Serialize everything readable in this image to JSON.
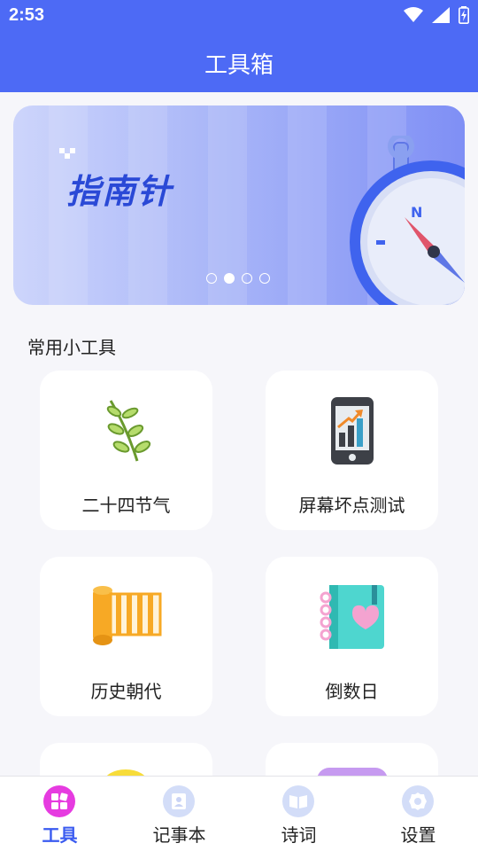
{
  "status_bar": {
    "time": "2:53"
  },
  "app_bar": {
    "title": "工具箱"
  },
  "banner": {
    "title": "指南针",
    "page_indicator": {
      "count": 4,
      "active_index": 1
    }
  },
  "section": {
    "title": "常用小工具"
  },
  "tools": [
    {
      "label": "二十四节气",
      "icon": "leaf-branch-icon"
    },
    {
      "label": "屏幕坏点测试",
      "icon": "phone-chart-icon"
    },
    {
      "label": "历史朝代",
      "icon": "scroll-icon"
    },
    {
      "label": "倒数日",
      "icon": "heart-notebook-icon"
    }
  ],
  "bottom_nav": {
    "active_index": 0,
    "items": [
      {
        "label": "工具",
        "icon": "grid-icon"
      },
      {
        "label": "记事本",
        "icon": "contact-book-icon"
      },
      {
        "label": "诗词",
        "icon": "open-book-icon"
      },
      {
        "label": "设置",
        "icon": "gear-icon"
      }
    ]
  },
  "colors": {
    "primary": "#4d6af5",
    "accent": "#e63be0",
    "background": "#f6f6fa"
  }
}
